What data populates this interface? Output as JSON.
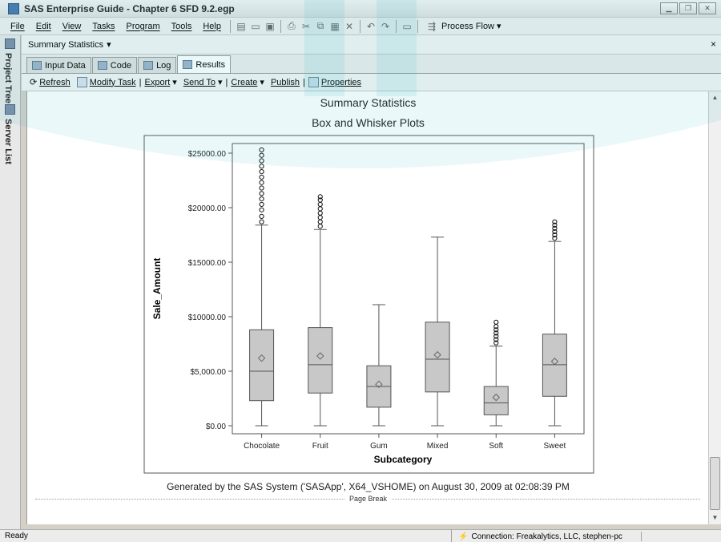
{
  "window": {
    "title": "SAS Enterprise Guide - Chapter 6 SFD 9.2.egp"
  },
  "menubar": {
    "items": [
      "File",
      "Edit",
      "View",
      "Tasks",
      "Program",
      "Tools",
      "Help"
    ],
    "process_flow_label": "Process Flow"
  },
  "sidebar": {
    "project_tree": "Project Tree",
    "server_list": "Server List"
  },
  "doc_header": {
    "title": "Summary Statistics"
  },
  "tabs": [
    "Input Data",
    "Code",
    "Log",
    "Results"
  ],
  "results_toolbar": {
    "refresh": "Refresh",
    "modify_task": "Modify Task",
    "export": "Export",
    "send_to": "Send To",
    "create": "Create",
    "publish": "Publish",
    "properties": "Properties"
  },
  "report": {
    "title": "Summary Statistics",
    "subtitle": "Box and Whisker Plots",
    "footer": "Generated by the SAS System ('SASApp', X64_VSHOME) on August 30, 2009 at 02:08:39 PM",
    "page_break": "Page Break"
  },
  "chart_data": {
    "type": "box",
    "xlabel": "Subcategory",
    "ylabel": "Sale_Amount",
    "ylim": [
      0,
      25000
    ],
    "y_ticks": [
      {
        "value": 0,
        "label": "$0.00"
      },
      {
        "value": 5000,
        "label": "$5,000.00"
      },
      {
        "value": 10000,
        "label": "$10000.00"
      },
      {
        "value": 15000,
        "label": "$15000.00"
      },
      {
        "value": 20000,
        "label": "$20000.00"
      },
      {
        "value": 25000,
        "label": "$25000.00"
      }
    ],
    "categories": [
      "Chocolate",
      "Fruit",
      "Gum",
      "Mixed",
      "Soft",
      "Sweet"
    ],
    "boxes": [
      {
        "min": 0,
        "q1": 2300,
        "median": 5000,
        "q3": 8800,
        "max": 18400,
        "mean": 6200,
        "outliers": [
          18700,
          19200,
          19800,
          20300,
          20800,
          21300,
          21800,
          22300,
          22800,
          23300,
          23800,
          24300,
          24800,
          25300
        ]
      },
      {
        "min": 0,
        "q1": 3000,
        "median": 5600,
        "q3": 9000,
        "max": 18000,
        "mean": 6400,
        "outliers": [
          18300,
          18700,
          19100,
          19500,
          19900,
          20300,
          20700,
          21000
        ]
      },
      {
        "min": 0,
        "q1": 1700,
        "median": 3600,
        "q3": 5500,
        "max": 11100,
        "mean": 3800,
        "outliers": []
      },
      {
        "min": 0,
        "q1": 3100,
        "median": 6100,
        "q3": 9500,
        "max": 17300,
        "mean": 6500,
        "outliers": []
      },
      {
        "min": 0,
        "q1": 1000,
        "median": 2100,
        "q3": 3600,
        "max": 7300,
        "mean": 2600,
        "outliers": [
          7600,
          7900,
          8200,
          8500,
          8800,
          9100,
          9500
        ]
      },
      {
        "min": 0,
        "q1": 2700,
        "median": 5600,
        "q3": 8400,
        "max": 16900,
        "mean": 5900,
        "outliers": [
          17200,
          17500,
          17800,
          18100,
          18400,
          18700
        ]
      }
    ]
  },
  "status": {
    "ready": "Ready",
    "connection": "Connection: Freakalytics, LLC, stephen-pc"
  }
}
